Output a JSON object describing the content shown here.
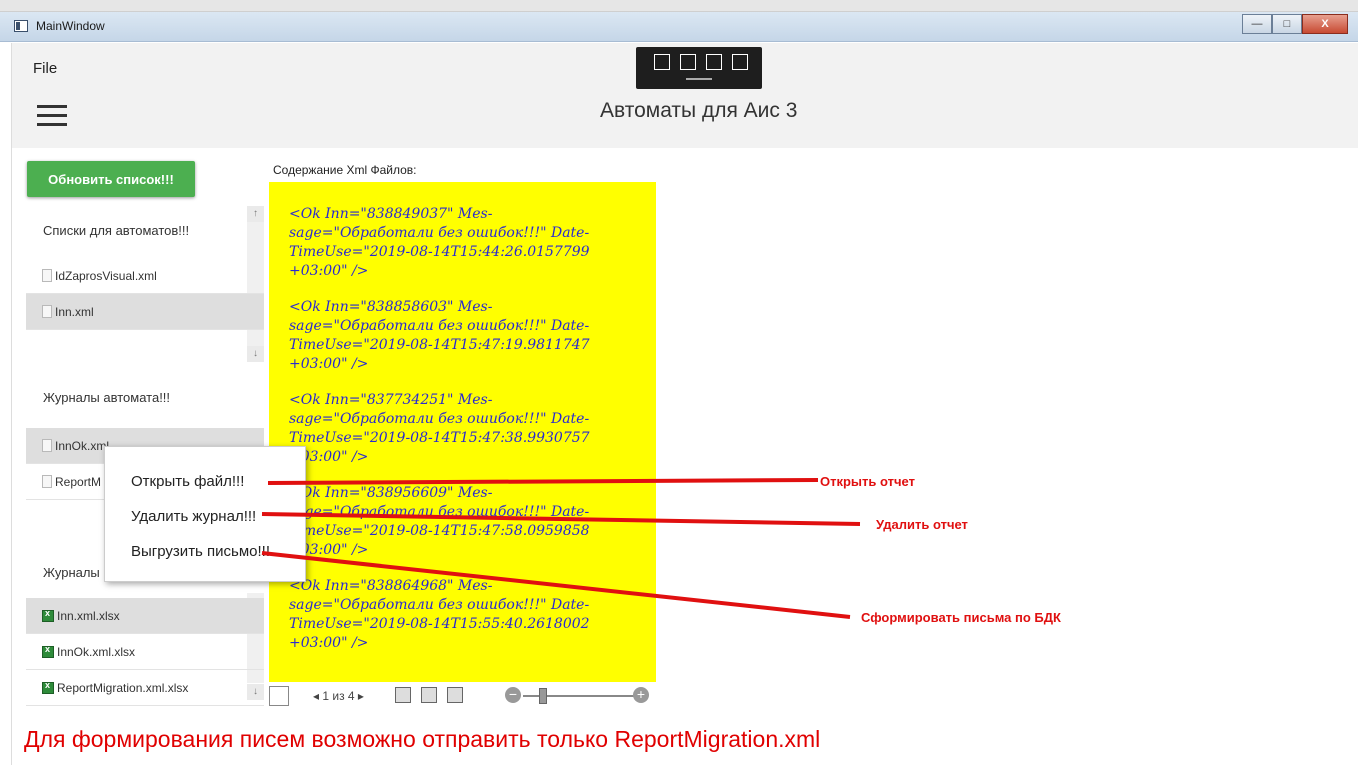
{
  "window": {
    "title": "MainWindow",
    "min_glyph": "—",
    "max_glyph": "□",
    "close_glyph": "X"
  },
  "menu": {
    "file": "File"
  },
  "app": {
    "title": "Автоматы для Аис 3"
  },
  "sidebar": {
    "refresh_button": "Обновить список!!!",
    "section1": "Списки для автоматов!!!",
    "lists": [
      {
        "label": "IdZaprosVisual.xml"
      },
      {
        "label": "Inn.xml"
      }
    ],
    "section2": "Журналы автомата!!!",
    "journals": [
      {
        "label": "InnOk.xml"
      },
      {
        "label": "ReportM"
      }
    ],
    "section3": "Журналы",
    "excel": [
      {
        "label": "Inn.xml.xlsx"
      },
      {
        "label": "InnOk.xml.xlsx"
      },
      {
        "label": "ReportMigration.xml.xlsx"
      }
    ]
  },
  "content": {
    "label": "Содержание Xml Файлов:",
    "entries": [
      "<Ok Inn=\"838849037\" Mes-sage=\"Обработали без ошибок!!!\" Date-TimeUse=\"2019-08-14T15:44:26.0157799 +03:00\" />",
      "<Ok Inn=\"838858603\" Mes-sage=\"Обработали без ошибок!!!\" Date-TimeUse=\"2019-08-14T15:47:19.9811747 +03:00\" />",
      "<Ok Inn=\"837734251\" Mes-sage=\"Обработали без ошибок!!!\" Date-TimeUse=\"2019-08-14T15:47:38.9930757 +03:00\" />",
      "<Ok Inn=\"838956609\" Mes-sage=\"Обработали без ошибок!!!\" Date-TimeUse=\"2019-08-14T15:47:58.0959858 +03:00\" />",
      "<Ok Inn=\"838864968\" Mes-sage=\"Обработали без ошибок!!!\" Date-TimeUse=\"2019-08-14T15:55:40.2618002 +03:00\" />"
    ]
  },
  "viewer": {
    "page_text": "◂ 1 из 4 ▸",
    "minus": "−",
    "plus": "+"
  },
  "context_menu": {
    "open": "Открыть файл!!!",
    "delete": "Удалить журнал!!!",
    "export": "Выгрузить письмо!!!"
  },
  "annotations": {
    "open": "Открыть отчет",
    "delete": "Удалить отчет",
    "export": "Сформировать письма по БДК"
  },
  "bottom_note": "Для формирования писем возможно отправить только ReportMigration.xml",
  "colors": {
    "accent_green": "#4caf50",
    "highlight_yellow": "#ffff00",
    "annotation_red": "#e01010",
    "entry_blue": "#2a2ad0"
  }
}
